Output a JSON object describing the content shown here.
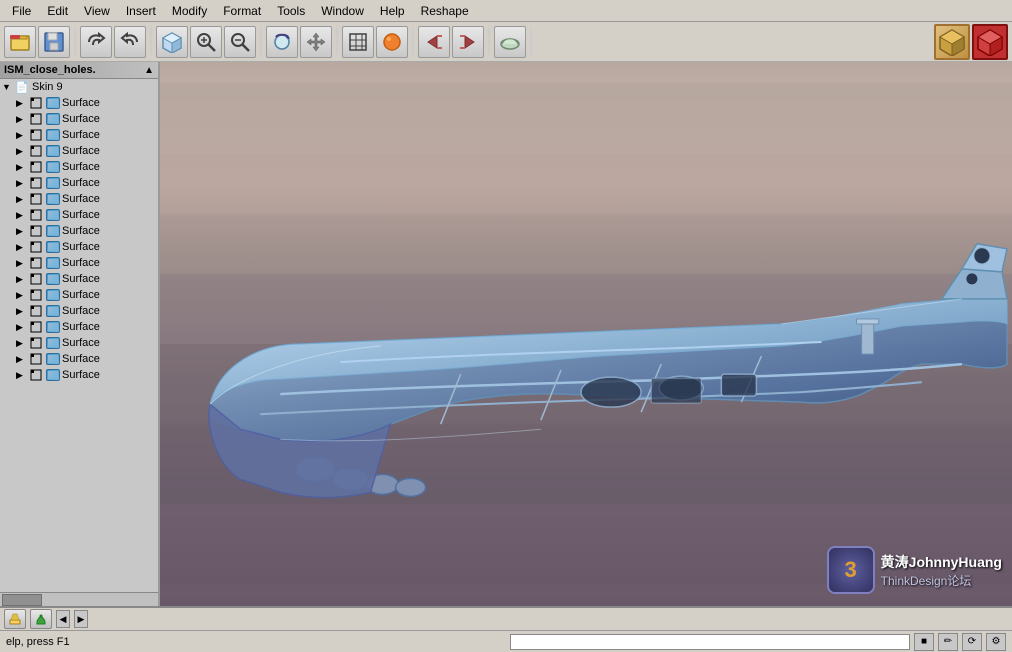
{
  "menubar": {
    "items": [
      "File",
      "Edit",
      "View",
      "Insert",
      "Modify",
      "Format",
      "Tools",
      "Window",
      "Help",
      "Reshape"
    ]
  },
  "toolbar": {
    "groups": [
      {
        "buttons": [
          "open-icon",
          "save-icon"
        ]
      },
      {
        "buttons": [
          "undo-icon",
          "redo-icon"
        ]
      },
      {
        "buttons": [
          "views-icon"
        ]
      },
      {
        "buttons": [
          "zoom-box-icon",
          "zoom-fit-icon"
        ]
      },
      {
        "buttons": [
          "rotate-icon",
          "pan-icon"
        ]
      },
      {
        "buttons": [
          "grid-icon",
          "layers-icon"
        ]
      },
      {
        "buttons": [
          "more-icon"
        ]
      }
    ]
  },
  "tree": {
    "title": "ISM_close_holes.",
    "root": {
      "label": "Skin 9",
      "expanded": true
    },
    "items": [
      {
        "label": "Surface",
        "indent": 1
      },
      {
        "label": "Surface",
        "indent": 1
      },
      {
        "label": "Surface",
        "indent": 1
      },
      {
        "label": "Surface",
        "indent": 1
      },
      {
        "label": "Surface",
        "indent": 1
      },
      {
        "label": "Surface",
        "indent": 1
      },
      {
        "label": "Surface",
        "indent": 1
      },
      {
        "label": "Surface",
        "indent": 1
      },
      {
        "label": "Surface",
        "indent": 1
      },
      {
        "label": "Surface",
        "indent": 1
      },
      {
        "label": "Surface",
        "indent": 1
      },
      {
        "label": "Surface",
        "indent": 1
      },
      {
        "label": "Surface",
        "indent": 1
      },
      {
        "label": "Surface",
        "indent": 1
      },
      {
        "label": "Surface",
        "indent": 1
      },
      {
        "label": "Surface",
        "indent": 1
      },
      {
        "label": "Surface",
        "indent": 1
      },
      {
        "label": "Surface",
        "indent": 1
      }
    ]
  },
  "watermark": {
    "number": "3",
    "line1": "黄涛JohnnyHuang",
    "line2": "ThinkDesign论坛"
  },
  "statusbar": {
    "left_text": "elp, press F1"
  },
  "bottom_toolbar": {
    "buttons": [
      "pencil",
      "bucket",
      "arrow-left",
      "arrow-right",
      "nav-left",
      "nav-right"
    ]
  }
}
